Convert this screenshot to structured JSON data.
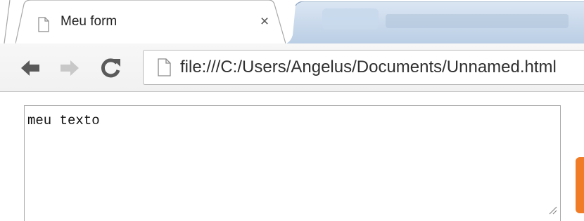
{
  "browser": {
    "tabs": [
      {
        "title": "Meu form",
        "active": true,
        "icon": "page-icon",
        "close_glyph": "×"
      }
    ],
    "toolbar": {
      "back_icon": "arrow-left-icon",
      "forward_icon": "arrow-right-icon",
      "reload_icon": "reload-icon",
      "url": "file:///C:/Users/Angelus/Documents/Unnamed.html",
      "url_icon": "page-icon"
    }
  },
  "page": {
    "textarea": {
      "value": "meu texto"
    }
  },
  "colors": {
    "active_tab_bg": "#ffffff",
    "inactive_tab_bg": "#c4d6ea",
    "toolbar_bg": "#f3f3f3",
    "accent_marker": "#f07c28"
  }
}
